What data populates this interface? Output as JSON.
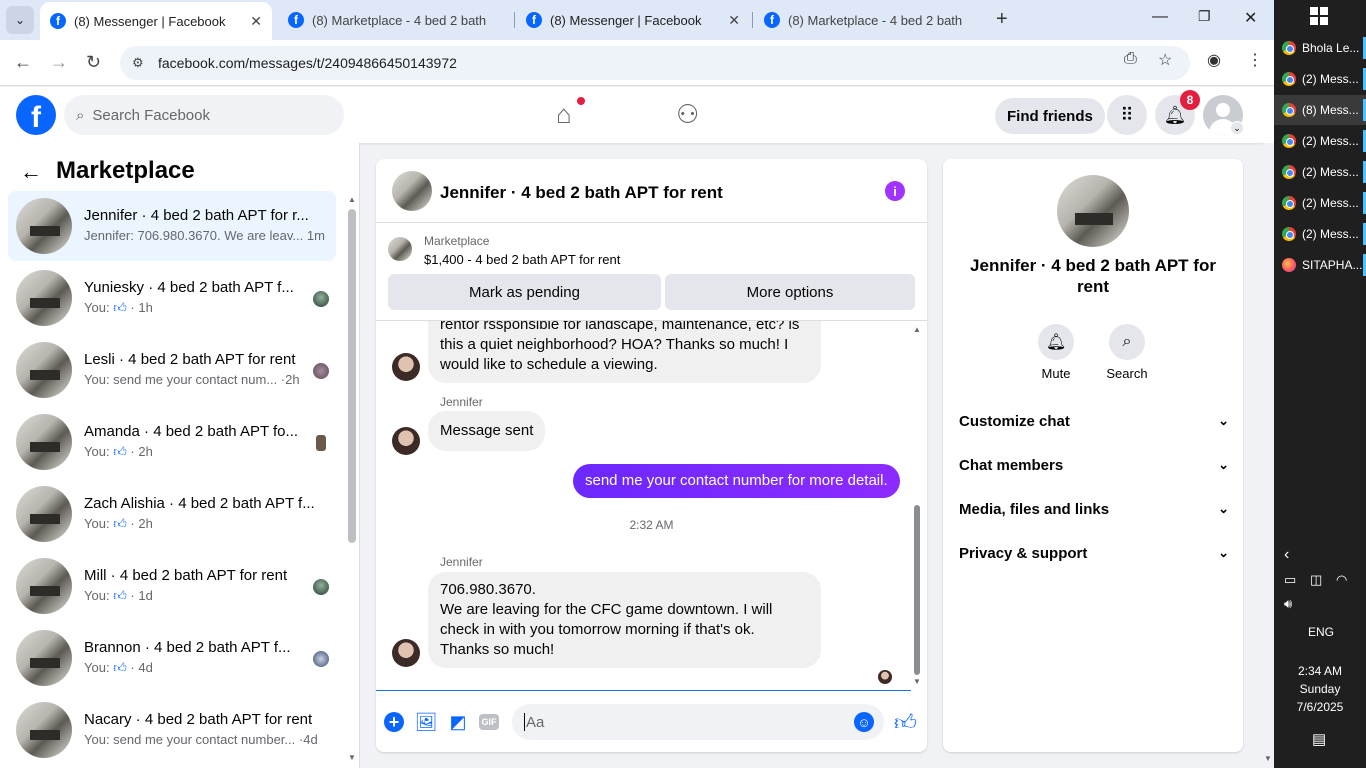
{
  "browser": {
    "tabs": [
      {
        "title": "(8) Messenger | Facebook",
        "active": true
      },
      {
        "title": "(8) Marketplace - 4 bed 2 bath",
        "active": false
      },
      {
        "title": "(8) Messenger | Facebook",
        "active": false
      },
      {
        "title": "(8) Marketplace - 4 bed 2 bath",
        "active": false
      }
    ],
    "url": "facebook.com/messages/t/24094866450143972"
  },
  "fb_header": {
    "search_placeholder": "Search Facebook",
    "find_friends": "Find friends",
    "notification_count": "8"
  },
  "sidebar": {
    "title": "Marketplace",
    "conversations": [
      {
        "name": "Jennifer · 4 bed 2 bath APT for r...",
        "preview": "Jennifer: 706.980.3670. We are leav...",
        "time": "1m",
        "active": true
      },
      {
        "name": "Yuniesky · 4 bed 2 bath APT f...",
        "preview_prefix": "You:",
        "time": "1h",
        "liked": true
      },
      {
        "name": "Lesli · 4 bed 2 bath APT for rent",
        "preview": "You: send me your contact num...",
        "time": "2h"
      },
      {
        "name": "Amanda · 4 bed 2 bath APT fo...",
        "preview_prefix": "You:",
        "time": "2h",
        "liked": true
      },
      {
        "name": "Zach Alishia · 4 bed 2 bath APT f...",
        "preview_prefix": "You:",
        "time": "2h",
        "liked": true
      },
      {
        "name": "Mill · 4 bed 2 bath APT for rent",
        "preview_prefix": "You:",
        "time": "1d",
        "liked": true
      },
      {
        "name": "Brannon · 4 bed 2 bath APT f...",
        "preview_prefix": "You:",
        "time": "4d",
        "liked": true
      },
      {
        "name": "Nacary · 4 bed 2 bath APT for rent",
        "preview": "You: send me your contact number...",
        "time": "4d"
      }
    ]
  },
  "chat": {
    "title": "Jennifer · 4 bed 2 bath APT for rent",
    "marketplace_label": "Marketplace",
    "listing": "$1,400 - 4 bed 2 bath APT for rent",
    "mark_pending": "Mark as pending",
    "more_options": "More options",
    "messages": {
      "partial_line1": "rentor rssponsible for landscape, maintenance, etc? is",
      "partial_line2": "this a quiet neighborhood? HOA? Thanks so much! I",
      "partial_line3": "would like to schedule a viewing.",
      "sender1": "Jennifer",
      "msg_sent": "Message sent",
      "outgoing": "send me your contact number for more detail.",
      "time": "2:32 AM",
      "sender2": "Jennifer",
      "last_line1": "706.980.3670.",
      "last_line2": "We are leaving for the CFC game downtown. I will",
      "last_line3": "check in with you tomorrow morning if that's ok.",
      "last_line4": "Thanks so much!"
    },
    "composer_placeholder": "Aa"
  },
  "info_panel": {
    "name": "Jennifer · 4 bed 2 bath APT for rent",
    "mute": "Mute",
    "search": "Search",
    "sections": [
      "Customize chat",
      "Chat members",
      "Media, files and links",
      "Privacy & support"
    ]
  },
  "taskbar": {
    "items": [
      {
        "label": "Bhola Le..."
      },
      {
        "label": "(2) Mess..."
      },
      {
        "label": "(8) Mess..."
      },
      {
        "label": "(2) Mess..."
      },
      {
        "label": "(2) Mess..."
      },
      {
        "label": "(2) Mess..."
      },
      {
        "label": "(2) Mess..."
      },
      {
        "label": "SITAPHA..."
      }
    ],
    "language": "ENG",
    "time": "2:34 AM",
    "day": "Sunday",
    "date": "7/6/2025"
  },
  "colors": {
    "fb_blue": "#0866ff",
    "outgoing_bubble": "#7b1fff",
    "active_conv_bg": "#ebf5ff",
    "notification_red": "#e41e3f"
  }
}
